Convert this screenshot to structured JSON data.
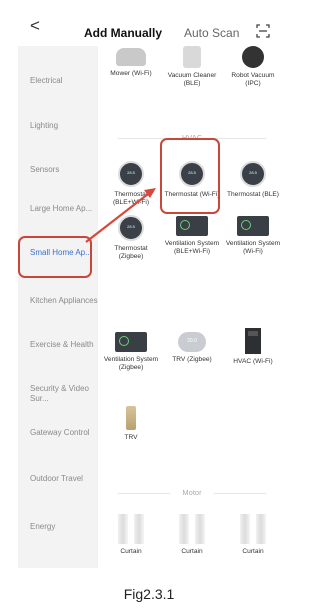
{
  "header": {
    "back_glyph": "<",
    "tab_manual": "Add Manually",
    "tab_auto": "Auto Scan"
  },
  "sidebar": {
    "items": [
      {
        "label": "Electrical"
      },
      {
        "label": "Lighting"
      },
      {
        "label": "Sensors"
      },
      {
        "label": "Large Home Ap..."
      },
      {
        "label": "Small Home Ap..."
      },
      {
        "label": "Kitchen Appliances"
      },
      {
        "label": "Exercise & Health"
      },
      {
        "label": "Security & Video Sur..."
      },
      {
        "label": "Gateway Control"
      },
      {
        "label": "Outdoor Travel"
      },
      {
        "label": "Energy"
      }
    ]
  },
  "top_row": [
    {
      "label": "Mower (Wi-Fi)"
    },
    {
      "label": "Vacuum Cleaner (BLE)"
    },
    {
      "label": "Robot Vacuum (IPC)"
    }
  ],
  "sections": {
    "hvac": "HVAC",
    "motor": "Motor"
  },
  "hvac_items": [
    {
      "label": "Thermostat (BLE+Wi-Fi)"
    },
    {
      "label": "Thermostat (Wi-Fi)"
    },
    {
      "label": "Thermostat (BLE)"
    },
    {
      "label": "Thermostat (Zigbee)"
    },
    {
      "label": "Ventilation System (BLE+Wi-Fi)"
    },
    {
      "label": "Ventilation System (Wi-Fi)"
    },
    {
      "label": "Ventilation System (Zigbee)"
    },
    {
      "label": "TRV (Zigbee)"
    },
    {
      "label": "HVAC (Wi-Fi)"
    },
    {
      "label": "TRV"
    }
  ],
  "motor_items": [
    {
      "label": "Curtain"
    },
    {
      "label": "Curtain"
    },
    {
      "label": "Curtain"
    }
  ],
  "thermo_face_text": "28.5",
  "trv_face_text": "20.0",
  "caption": "Fig2.3.1",
  "colors": {
    "active_side": "#3a6fd1",
    "highlight": "#c8473b",
    "arrow": "#d9463a"
  }
}
